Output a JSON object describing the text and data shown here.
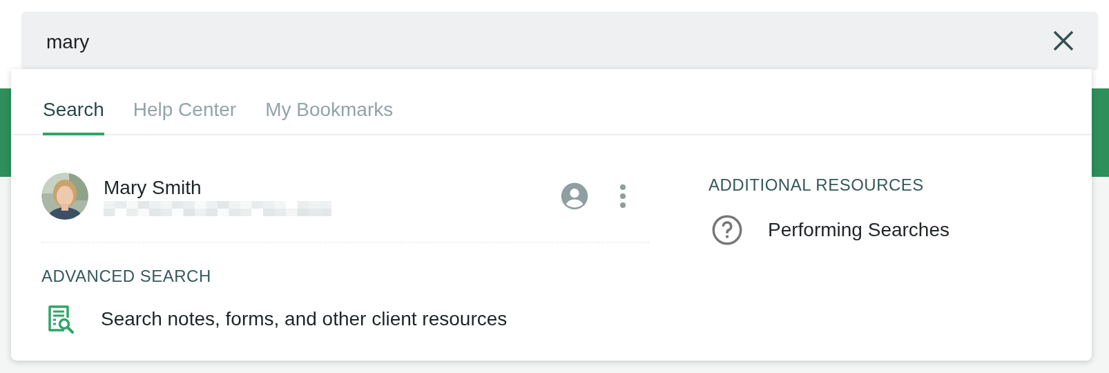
{
  "search_field": {
    "value": "mary"
  },
  "tabs": [
    {
      "label": "Search",
      "selected": true
    },
    {
      "label": "Help Center",
      "selected": false
    },
    {
      "label": "My Bookmarks",
      "selected": false
    }
  ],
  "results": [
    {
      "name": "Mary Smith",
      "kind": "person"
    }
  ],
  "advanced_search": {
    "heading": "ADVANCED SEARCH",
    "link": "Search notes, forms, and other client resources"
  },
  "additional_resources": {
    "heading": "ADDITIONAL RESOURCES",
    "items": [
      {
        "label": "Performing Searches"
      }
    ]
  }
}
